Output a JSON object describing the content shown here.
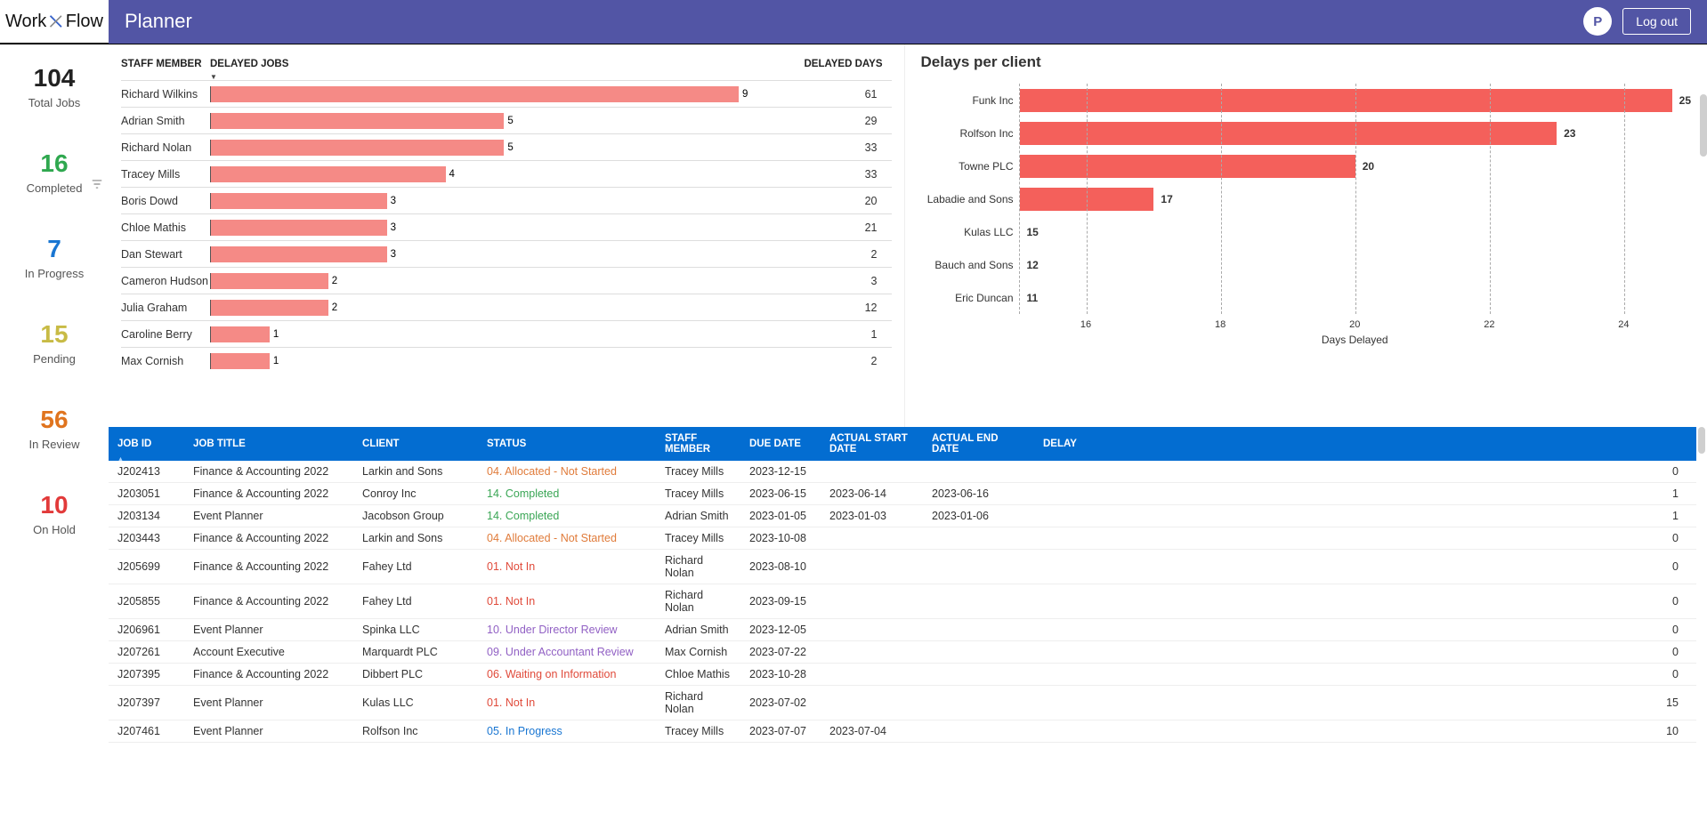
{
  "header": {
    "app": "Planner",
    "avatar": "P",
    "logout": "Log out"
  },
  "logo": {
    "w": "Work",
    "f": "Flow"
  },
  "stats": [
    {
      "num": "104",
      "label": "Total Jobs",
      "color": "#222"
    },
    {
      "num": "16",
      "label": "Completed",
      "color": "#2fa84f"
    },
    {
      "num": "7",
      "label": "In Progress",
      "color": "#1976d2"
    },
    {
      "num": "15",
      "label": "Pending",
      "color": "#c8bb45"
    },
    {
      "num": "56",
      "label": "In Review",
      "color": "#e0741e"
    },
    {
      "num": "10",
      "label": "On Hold",
      "color": "#e23a3a"
    }
  ],
  "staff_headers": {
    "name": "STAFF MEMBER",
    "jobs": "DELAYED JOBS",
    "days": "DELAYED DAYS"
  },
  "staff": [
    {
      "name": "Richard Wilkins",
      "jobs": 9,
      "days": 61
    },
    {
      "name": "Adrian Smith",
      "jobs": 5,
      "days": 29
    },
    {
      "name": "Richard Nolan",
      "jobs": 5,
      "days": 33
    },
    {
      "name": "Tracey Mills",
      "jobs": 4,
      "days": 33
    },
    {
      "name": "Boris Dowd",
      "jobs": 3,
      "days": 20
    },
    {
      "name": "Chloe Mathis",
      "jobs": 3,
      "days": 21
    },
    {
      "name": "Dan Stewart",
      "jobs": 3,
      "days": 2
    },
    {
      "name": "Cameron Hudson",
      "jobs": 2,
      "days": 3
    },
    {
      "name": "Julia Graham",
      "jobs": 2,
      "days": 12
    },
    {
      "name": "Caroline Berry",
      "jobs": 1,
      "days": 1
    },
    {
      "name": "Max Cornish",
      "jobs": 1,
      "days": 2
    }
  ],
  "chart_title": "Delays per client",
  "chart_xlabel": "Days Delayed",
  "chart_data": {
    "type": "bar",
    "orientation": "horizontal",
    "title": "Delays per client",
    "xlabel": "Days Delayed",
    "ylabel": "",
    "xlim": [
      15,
      25
    ],
    "xticks": [
      16,
      18,
      20,
      22,
      24
    ],
    "categories": [
      "Funk Inc",
      "Rolfson Inc",
      "Towne PLC",
      "Labadie and Sons",
      "Kulas LLC",
      "Bauch and Sons",
      "Eric Duncan"
    ],
    "values": [
      25,
      23,
      20,
      17,
      15,
      12,
      11
    ]
  },
  "table_headers": [
    "JOB ID",
    "JOB TITLE",
    "CLIENT",
    "STATUS",
    "STAFF MEMBER",
    "DUE DATE",
    "ACTUAL START DATE",
    "ACTUAL END DATE",
    "DELAY"
  ],
  "jobs": [
    {
      "id": "J202413",
      "title": "Finance & Accounting 2022",
      "client": "Larkin and Sons",
      "status": "04. Allocated - Not Started",
      "scls": "st-orange",
      "staff": "Tracey Mills",
      "due": "2023-12-15",
      "start": "",
      "end": "",
      "delay": "0"
    },
    {
      "id": "J203051",
      "title": "Finance & Accounting 2022",
      "client": "Conroy Inc",
      "status": "14. Completed",
      "scls": "st-green",
      "staff": "Tracey Mills",
      "due": "2023-06-15",
      "start": "2023-06-14",
      "end": "2023-06-16",
      "delay": "1"
    },
    {
      "id": "J203134",
      "title": "Event Planner",
      "client": "Jacobson Group",
      "status": "14. Completed",
      "scls": "st-green",
      "staff": "Adrian Smith",
      "due": "2023-01-05",
      "start": "2023-01-03",
      "end": "2023-01-06",
      "delay": "1"
    },
    {
      "id": "J203443",
      "title": "Finance & Accounting 2022",
      "client": "Larkin and Sons",
      "status": "04. Allocated - Not Started",
      "scls": "st-orange",
      "staff": "Tracey Mills",
      "due": "2023-10-08",
      "start": "",
      "end": "",
      "delay": "0"
    },
    {
      "id": "J205699",
      "title": "Finance & Accounting 2022",
      "client": "Fahey Ltd",
      "status": "01. Not In",
      "scls": "st-red",
      "staff": "Richard Nolan",
      "due": "2023-08-10",
      "start": "",
      "end": "",
      "delay": "0"
    },
    {
      "id": "J205855",
      "title": "Finance & Accounting 2022",
      "client": "Fahey Ltd",
      "status": "01. Not In",
      "scls": "st-red",
      "staff": "Richard Nolan",
      "due": "2023-09-15",
      "start": "",
      "end": "",
      "delay": "0"
    },
    {
      "id": "J206961",
      "title": "Event Planner",
      "client": "Spinka LLC",
      "status": "10. Under Director Review",
      "scls": "st-purple",
      "staff": "Adrian Smith",
      "due": "2023-12-05",
      "start": "",
      "end": "",
      "delay": "0"
    },
    {
      "id": "J207261",
      "title": "Account Executive",
      "client": "Marquardt PLC",
      "status": "09. Under Accountant Review",
      "scls": "st-purple",
      "staff": "Max Cornish",
      "due": "2023-07-22",
      "start": "",
      "end": "",
      "delay": "0"
    },
    {
      "id": "J207395",
      "title": "Finance & Accounting 2022",
      "client": "Dibbert PLC",
      "status": "06. Waiting on Information",
      "scls": "st-red",
      "staff": "Chloe Mathis",
      "due": "2023-10-28",
      "start": "",
      "end": "",
      "delay": "0"
    },
    {
      "id": "J207397",
      "title": "Event Planner",
      "client": "Kulas LLC",
      "status": "01. Not In",
      "scls": "st-red",
      "staff": "Richard Nolan",
      "due": "2023-07-02",
      "start": "",
      "end": "",
      "delay": "15"
    },
    {
      "id": "J207461",
      "title": "Event Planner",
      "client": "Rolfson Inc",
      "status": "05. In Progress",
      "scls": "st-blue",
      "staff": "Tracey Mills",
      "due": "2023-07-07",
      "start": "2023-07-04",
      "end": "",
      "delay": "10"
    }
  ]
}
